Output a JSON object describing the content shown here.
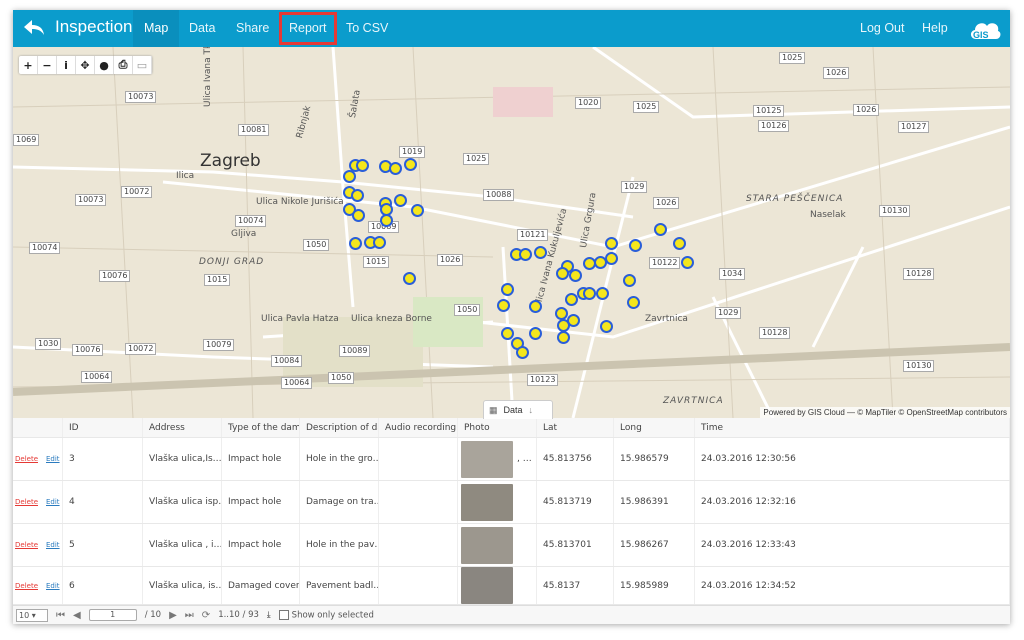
{
  "header": {
    "title": "Inspection",
    "nav": [
      "Map",
      "Data",
      "Share",
      "Report",
      "To CSV"
    ],
    "right": [
      "Log Out",
      "Help"
    ],
    "logo": "GIS",
    "active": "Map",
    "highlighted": "Report",
    "color": "#0b9ccc"
  },
  "map": {
    "tools": [
      "zoom-in",
      "zoom-out",
      "info",
      "locate",
      "globe",
      "print",
      "layers"
    ],
    "city": "Zagreb",
    "road_labels": [
      "10073",
      "10081",
      "1019",
      "1025",
      "1020",
      "1025",
      "1026",
      "10125",
      "10126",
      "10127",
      "10072",
      "10073",
      "1029",
      "1026",
      "10088",
      "10074",
      "10089",
      "1050",
      "10121",
      "10122",
      "1034",
      "10130",
      "10074",
      "1015",
      "1026",
      "10076",
      "1015",
      "1050",
      "1029",
      "10128",
      "1030",
      "10076",
      "10072",
      "10079",
      "10084",
      "10089",
      "10064",
      "10064",
      "1050",
      "10123",
      "10128",
      "10130",
      "1025",
      "1026",
      "1069"
    ],
    "street_names": [
      "Ilica",
      "Ulica Nikole Jurišića",
      "DONJI GRAD",
      "Ulica Pavla Hatza",
      "Ulica kneza Borne",
      "Zavrtnica",
      "STARA PEŠČENICA",
      "Naselak",
      "ZAVRTNICA",
      "Gljiva",
      "Ulica Ivana Tkalčića",
      "Šalata",
      "Ribnjak",
      "Ulica Grgura",
      "Ulica Ivana Kukuljevića"
    ],
    "attribution": "Powered by GIS Cloud — © MapTiler © OpenStreetMap contributors",
    "marker_fill": "#f4e61c",
    "marker_stroke": "#2a5ed8"
  },
  "data_tab": {
    "label": "Data"
  },
  "table": {
    "columns": [
      "",
      "ID",
      "Address",
      "Type of the dama",
      "Description of da",
      "Audio recording",
      "Photo",
      "Lat",
      "Long",
      "Time"
    ],
    "delete_label": "Delete",
    "edit_label": "Edit",
    "rows": [
      {
        "id": "3",
        "address": "Vlaška ulica,Is…",
        "type": "Impact hole",
        "description": "Hole in the gro…",
        "audio": "",
        "photo_extra": ", …",
        "lat": "45.813756",
        "long": "15.986579",
        "time": "24.03.2016 12:30:56"
      },
      {
        "id": "4",
        "address": "Vlaška ulica isp…",
        "type": "Impact hole",
        "description": "Damage on tra…",
        "audio": "",
        "photo_extra": "",
        "lat": "45.813719",
        "long": "15.986391",
        "time": "24.03.2016 12:32:16"
      },
      {
        "id": "5",
        "address": "Vlaška ulica , i…",
        "type": "Impact hole",
        "description": "Hole in the pav…",
        "audio": "",
        "photo_extra": "",
        "lat": "45.813701",
        "long": "15.986267",
        "time": "24.03.2016 12:33:43"
      },
      {
        "id": "6",
        "address": "Vlaška ulica, is…",
        "type": "Damaged covers",
        "description": "Pavement badl…",
        "audio": "",
        "photo_extra": "",
        "lat": "45.8137",
        "long": "15.985989",
        "time": "24.03.2016 12:34:52"
      }
    ]
  },
  "footer": {
    "page_size": "10",
    "page": "1",
    "page_total": "/ 10",
    "range": "1..10 / 93",
    "show_selected": "Show only selected"
  }
}
